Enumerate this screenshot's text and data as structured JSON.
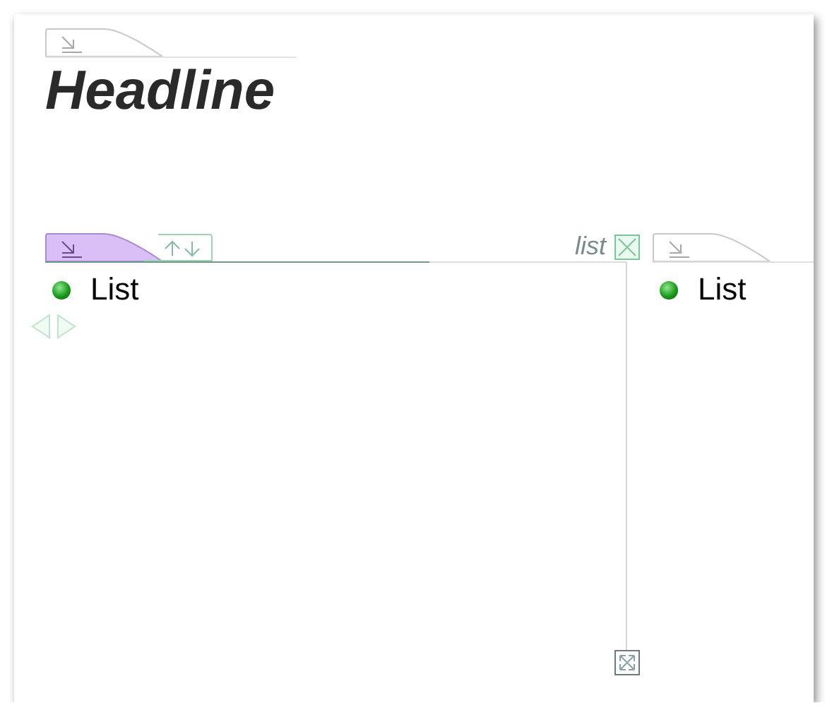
{
  "headline": {
    "text": "Headline"
  },
  "panels": [
    {
      "label": "list",
      "items": [
        {
          "text": "List"
        }
      ],
      "selected": true
    },
    {
      "items": [
        {
          "text": "List"
        }
      ],
      "selected": false
    }
  ]
}
